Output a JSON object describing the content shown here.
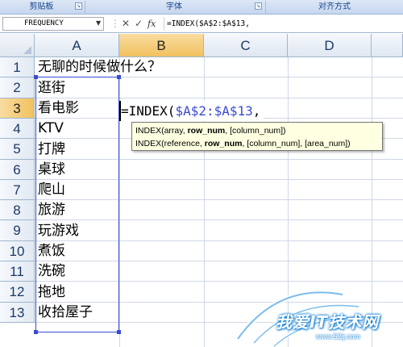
{
  "ribbon": {
    "groups": [
      "剪贴板",
      "字体",
      "对齐方式"
    ],
    "launcher_glyph": "↘"
  },
  "formula_bar": {
    "name_box_value": "FREQUENCY",
    "name_dropdown_glyph": "▼",
    "cancel_glyph": "✕",
    "enter_glyph": "✓",
    "fx_label": "fx",
    "formula_text": "=INDEX($A$2:$A$13,"
  },
  "grid": {
    "columns": [
      "A",
      "B",
      "C",
      "D"
    ],
    "rows": [
      "1",
      "2",
      "3",
      "4",
      "5",
      "6",
      "7",
      "8",
      "9",
      "10",
      "11",
      "12",
      "13"
    ],
    "column_a_values": [
      "无聊的时候做什么？",
      "逛街",
      "看电影",
      "KTV",
      "打牌",
      "桌球",
      "爬山",
      "旅游",
      "玩游戏",
      "煮饭",
      "洗碗",
      "拖地",
      "收拾屋子"
    ],
    "selected_column": "B",
    "selected_row": "3"
  },
  "edit_cell": {
    "prefix": "=INDEX(",
    "range_ref": "$A$2:$A$13",
    "suffix": ","
  },
  "tooltip": {
    "line1": {
      "pre": "INDEX(array, ",
      "bold": "row_num",
      "post": ", [column_num])"
    },
    "line2": {
      "pre": "INDEX(reference, ",
      "bold": "row_num",
      "post": ", [column_num], [area_num])"
    }
  },
  "watermark": {
    "text": "我爱IT技术网",
    "url": "www.52ij.com"
  },
  "colors": {
    "range_highlight": "#3a4bd3",
    "tooltip_bg": "#ffffe1",
    "header_selected": "#f1c15f"
  }
}
